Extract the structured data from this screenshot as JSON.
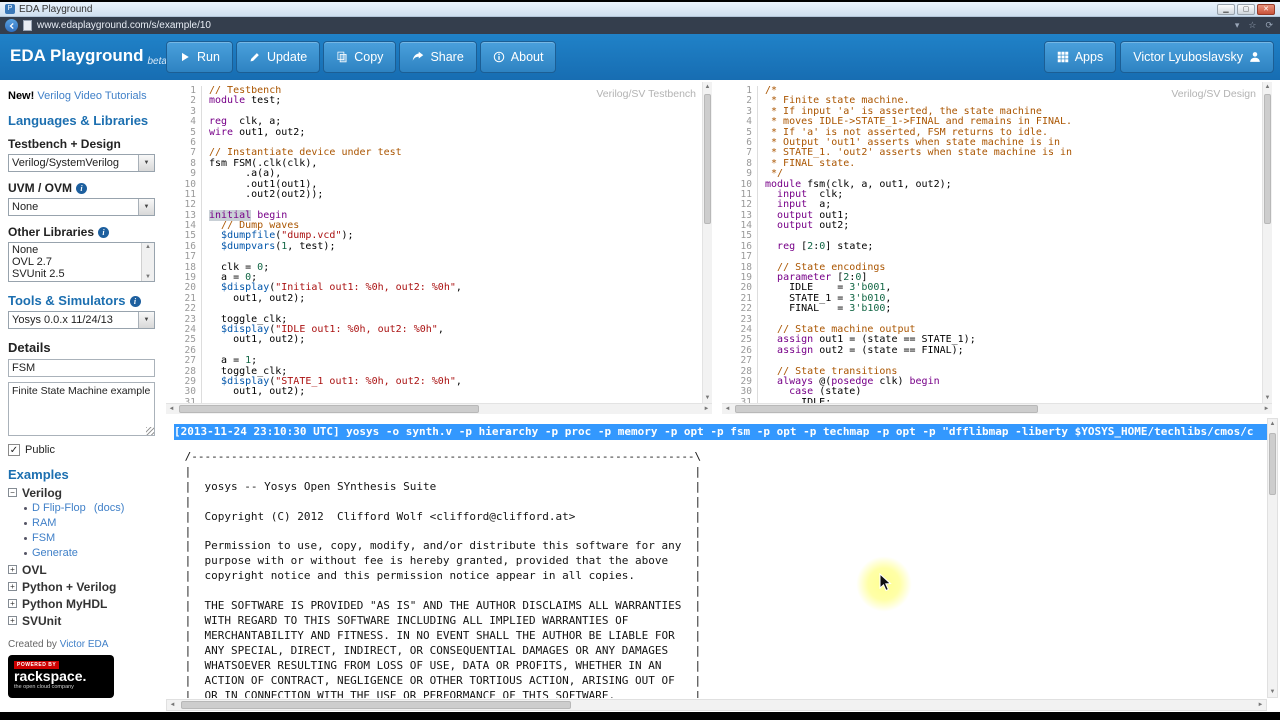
{
  "browser": {
    "tab_title": "EDA Playground",
    "url": "www.edaplayground.com/s/example/10"
  },
  "header": {
    "logo": "EDA Playground",
    "beta": "beta",
    "nav_buttons": [
      {
        "id": "run",
        "label": "Run",
        "icon": "play"
      },
      {
        "id": "update",
        "label": "Update",
        "icon": "pencil"
      },
      {
        "id": "copy",
        "label": "Copy",
        "icon": "copy"
      },
      {
        "id": "share",
        "label": "Share",
        "icon": "share"
      },
      {
        "id": "about",
        "label": "About",
        "icon": "info"
      }
    ],
    "right_buttons": [
      {
        "id": "apps",
        "label": "Apps",
        "icon": "grid"
      },
      {
        "id": "user",
        "label": "Victor Lyuboslavsky",
        "icon": "person",
        "icon_position": "right"
      }
    ]
  },
  "sidebar": {
    "promo_prefix": "New!",
    "promo_link": "Verilog Video Tutorials",
    "languages_heading": "Languages & Libraries",
    "testbench_label": "Testbench + Design",
    "testbench_select": "Verilog/SystemVerilog",
    "uvm_label": "UVM / OVM",
    "uvm_select": "None",
    "other_libs_label": "Other Libraries",
    "other_libs_options": [
      "None",
      "OVL 2.7",
      "SVUnit 2.5"
    ],
    "tools_heading": "Tools & Simulators",
    "tools_select": "Yosys 0.0.x 11/24/13",
    "details_heading": "Details",
    "name_value": "FSM",
    "description_value": "Finite State Machine example",
    "public_label": "Public",
    "public_checked": "✓",
    "examples_heading": "Examples",
    "examples_tree": [
      {
        "label": "Verilog",
        "expanded": true,
        "children": [
          {
            "label": "D Flip-Flop",
            "suffix": "(docs)"
          },
          {
            "label": "RAM"
          },
          {
            "label": "FSM"
          },
          {
            "label": "Generate"
          }
        ]
      },
      {
        "label": "OVL",
        "expanded": false
      },
      {
        "label": "Python + Verilog",
        "expanded": false
      },
      {
        "label": "Python MyHDL",
        "expanded": false
      },
      {
        "label": "SVUnit",
        "expanded": false
      }
    ],
    "created_by_prefix": "Created by",
    "created_by_link": "Victor EDA",
    "rackspace": {
      "powered_by": "POWERED BY",
      "name": "rackspace.",
      "tagline": "the open cloud company"
    }
  },
  "editors": {
    "testbench": {
      "label": "Verilog/SV Testbench",
      "lines": [
        [
          [
            "cm",
            "// Testbench"
          ]
        ],
        [
          [
            "kw",
            "module"
          ],
          [
            "pl",
            " test;"
          ]
        ],
        [],
        [
          [
            "kw",
            "reg"
          ],
          [
            "pl",
            "  clk, a;"
          ]
        ],
        [
          [
            "kw",
            "wire"
          ],
          [
            "pl",
            " out1, out2;"
          ]
        ],
        [],
        [
          [
            "cm",
            "// Instantiate device under test"
          ]
        ],
        [
          [
            "pl",
            "fsm FSM(.clk(clk),"
          ]
        ],
        [
          [
            "pl",
            "      .a(a),"
          ]
        ],
        [
          [
            "pl",
            "      .out1(out1),"
          ]
        ],
        [
          [
            "pl",
            "      .out2(out2));"
          ]
        ],
        [],
        [
          [
            "kw sel",
            "initial"
          ],
          [
            "pl",
            " "
          ],
          [
            "kw",
            "begin"
          ]
        ],
        [
          [
            "pl",
            "  "
          ],
          [
            "cm",
            "// Dump waves"
          ]
        ],
        [
          [
            "pl",
            "  "
          ],
          [
            "sys",
            "$dumpfile"
          ],
          [
            "pl",
            "("
          ],
          [
            "str",
            "\"dump.vcd\""
          ],
          [
            "pl",
            ");"
          ]
        ],
        [
          [
            "pl",
            "  "
          ],
          [
            "sys",
            "$dumpvars"
          ],
          [
            "pl",
            "("
          ],
          [
            "num",
            "1"
          ],
          [
            "pl",
            ", test);"
          ]
        ],
        [],
        [
          [
            "pl",
            "  clk = "
          ],
          [
            "num",
            "0"
          ],
          [
            "pl",
            ";"
          ]
        ],
        [
          [
            "pl",
            "  a = "
          ],
          [
            "num",
            "0"
          ],
          [
            "pl",
            ";"
          ]
        ],
        [
          [
            "pl",
            "  "
          ],
          [
            "sys",
            "$display"
          ],
          [
            "pl",
            "("
          ],
          [
            "str",
            "\"Initial out1: %0h, out2: %0h\""
          ],
          [
            "pl",
            ","
          ]
        ],
        [
          [
            "pl",
            "    out1, out2);"
          ]
        ],
        [],
        [
          [
            "pl",
            "  toggle_clk;"
          ]
        ],
        [
          [
            "pl",
            "  "
          ],
          [
            "sys",
            "$display"
          ],
          [
            "pl",
            "("
          ],
          [
            "str",
            "\"IDLE out1: %0h, out2: %0h\""
          ],
          [
            "pl",
            ","
          ]
        ],
        [
          [
            "pl",
            "    out1, out2);"
          ]
        ],
        [],
        [
          [
            "pl",
            "  a = "
          ],
          [
            "num",
            "1"
          ],
          [
            "pl",
            ";"
          ]
        ],
        [
          [
            "pl",
            "  toggle_clk;"
          ]
        ],
        [
          [
            "pl",
            "  "
          ],
          [
            "sys",
            "$display"
          ],
          [
            "pl",
            "("
          ],
          [
            "str",
            "\"STATE_1 out1: %0h, out2: %0h\""
          ],
          [
            "pl",
            ","
          ]
        ],
        [
          [
            "pl",
            "    out1, out2);"
          ]
        ],
        []
      ]
    },
    "design": {
      "label": "Verilog/SV Design",
      "lines": [
        [
          [
            "cm",
            "/*"
          ]
        ],
        [
          [
            "cm",
            " * Finite state machine."
          ]
        ],
        [
          [
            "cm",
            " * If input 'a' is asserted, the state machine"
          ]
        ],
        [
          [
            "cm",
            " * moves IDLE->STATE_1->FINAL and remains in FINAL."
          ]
        ],
        [
          [
            "cm",
            " * If 'a' is not asserted, FSM returns to idle."
          ]
        ],
        [
          [
            "cm",
            " * Output 'out1' asserts when state machine is in"
          ]
        ],
        [
          [
            "cm",
            " * STATE_1. 'out2' asserts when state machine is in"
          ]
        ],
        [
          [
            "cm",
            " * FINAL state."
          ]
        ],
        [
          [
            "cm",
            " */"
          ]
        ],
        [
          [
            "kw",
            "module"
          ],
          [
            "pl",
            " fsm(clk, a, out1, out2);"
          ]
        ],
        [
          [
            "pl",
            "  "
          ],
          [
            "kw",
            "input"
          ],
          [
            "pl",
            "  clk;"
          ]
        ],
        [
          [
            "pl",
            "  "
          ],
          [
            "kw",
            "input"
          ],
          [
            "pl",
            "  a;"
          ]
        ],
        [
          [
            "pl",
            "  "
          ],
          [
            "kw",
            "output"
          ],
          [
            "pl",
            " out1;"
          ]
        ],
        [
          [
            "pl",
            "  "
          ],
          [
            "kw",
            "output"
          ],
          [
            "pl",
            " out2;"
          ]
        ],
        [],
        [
          [
            "pl",
            "  "
          ],
          [
            "kw",
            "reg"
          ],
          [
            "pl",
            " ["
          ],
          [
            "num",
            "2"
          ],
          [
            "pl",
            ":"
          ],
          [
            "num",
            "0"
          ],
          [
            "pl",
            "] state;"
          ]
        ],
        [],
        [
          [
            "pl",
            "  "
          ],
          [
            "cm",
            "// State encodings"
          ]
        ],
        [
          [
            "pl",
            "  "
          ],
          [
            "kw",
            "parameter"
          ],
          [
            "pl",
            " ["
          ],
          [
            "num",
            "2"
          ],
          [
            "pl",
            ":"
          ],
          [
            "num",
            "0"
          ],
          [
            "pl",
            "]"
          ]
        ],
        [
          [
            "pl",
            "    IDLE    = "
          ],
          [
            "num",
            "3'b001"
          ],
          [
            "pl",
            ","
          ]
        ],
        [
          [
            "pl",
            "    STATE_1 = "
          ],
          [
            "num",
            "3'b010"
          ],
          [
            "pl",
            ","
          ]
        ],
        [
          [
            "pl",
            "    FINAL   = "
          ],
          [
            "num",
            "3'b100"
          ],
          [
            "pl",
            ";"
          ]
        ],
        [],
        [
          [
            "pl",
            "  "
          ],
          [
            "cm",
            "// State machine output"
          ]
        ],
        [
          [
            "pl",
            "  "
          ],
          [
            "kw",
            "assign"
          ],
          [
            "pl",
            " out1 = (state == STATE_1);"
          ]
        ],
        [
          [
            "pl",
            "  "
          ],
          [
            "kw",
            "assign"
          ],
          [
            "pl",
            " out2 = (state == FINAL);"
          ]
        ],
        [],
        [
          [
            "pl",
            "  "
          ],
          [
            "cm",
            "// State transitions"
          ]
        ],
        [
          [
            "pl",
            "  "
          ],
          [
            "kw",
            "always"
          ],
          [
            "pl",
            " @("
          ],
          [
            "kw",
            "posedge"
          ],
          [
            "pl",
            " clk) "
          ],
          [
            "kw",
            "begin"
          ]
        ],
        [
          [
            "pl",
            "    "
          ],
          [
            "kw",
            "case"
          ],
          [
            "pl",
            " (state)"
          ]
        ],
        [
          [
            "pl",
            "      IDLE:"
          ]
        ]
      ]
    }
  },
  "console": {
    "command": "[2013-11-24 23:10:30 UTC] yosys -o synth.v -p hierarchy -p proc -p memory -p opt -p fsm -p opt -p techmap -p opt -p \"dfflibmap -liberty $YOSYS_HOME/techlibs/cmos/c",
    "lines": [
      " /----------------------------------------------------------------------------\\",
      " |                                                                            |",
      " |  yosys -- Yosys Open SYnthesis Suite                                       |",
      " |                                                                            |",
      " |  Copyright (C) 2012  Clifford Wolf <clifford@clifford.at>                  |",
      " |                                                                            |",
      " |  Permission to use, copy, modify, and/or distribute this software for any  |",
      " |  purpose with or without fee is hereby granted, provided that the above    |",
      " |  copyright notice and this permission notice appear in all copies.         |",
      " |                                                                            |",
      " |  THE SOFTWARE IS PROVIDED \"AS IS\" AND THE AUTHOR DISCLAIMS ALL WARRANTIES  |",
      " |  WITH REGARD TO THIS SOFTWARE INCLUDING ALL IMPLIED WARRANTIES OF          |",
      " |  MERCHANTABILITY AND FITNESS. IN NO EVENT SHALL THE AUTHOR BE LIABLE FOR   |",
      " |  ANY SPECIAL, DIRECT, INDIRECT, OR CONSEQUENTIAL DAMAGES OR ANY DAMAGES    |",
      " |  WHATSOEVER RESULTING FROM LOSS OF USE, DATA OR PROFITS, WHETHER IN AN     |",
      " |  ACTION OF CONTRACT, NEGLIGENCE OR OTHER TORTIOUS ACTION, ARISING OUT OF   |",
      " |  OR IN CONNECTION WITH THE USE OR PERFORMANCE OF THIS SOFTWARE.            |"
    ]
  },
  "colors": {
    "header_blue": "#1d7ec7",
    "console_highlight": "#3398fe",
    "code_keyword": "#770088",
    "code_comment": "#aa5500",
    "code_string": "#aa1111",
    "code_number": "#116644",
    "code_system": "#0055aa",
    "rackspace_red": "#cc0000"
  }
}
